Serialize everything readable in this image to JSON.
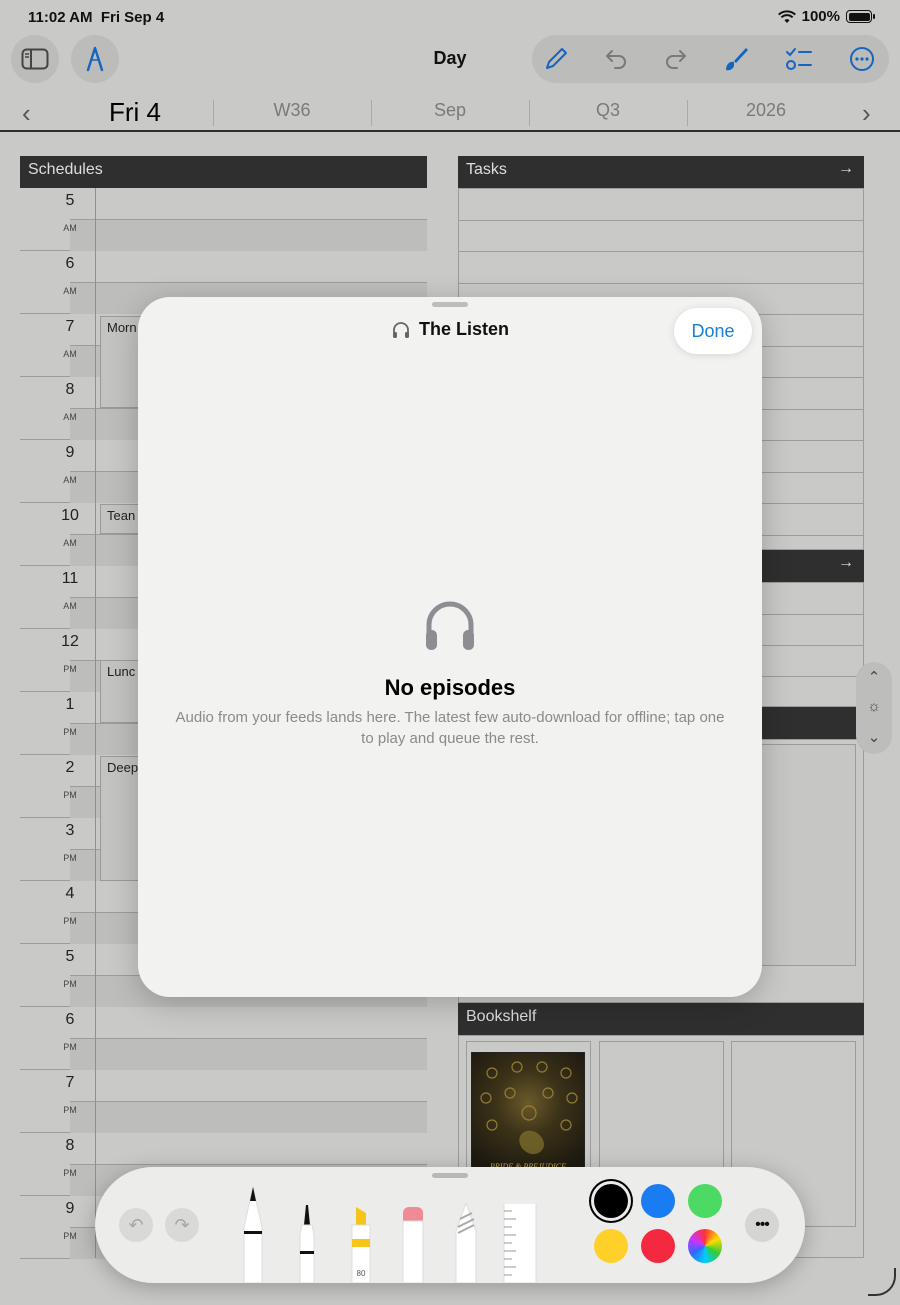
{
  "status_bar": {
    "time": "11:02 AM",
    "date": "Fri Sep 4",
    "battery": "100%"
  },
  "toolbar": {
    "title": "Day",
    "left_icons": [
      "sidebar-icon",
      "pen-mode-icon"
    ],
    "right_icons": [
      "pencil-icon",
      "undo-icon",
      "redo-icon",
      "brush-icon",
      "checklist-icon",
      "more-icon"
    ]
  },
  "date_nav": {
    "day": "Fri 4",
    "week": "W36",
    "month": "Sep",
    "quarter": "Q3",
    "year": "2026"
  },
  "schedules": {
    "header": "Schedules",
    "hours": [
      {
        "num": "5",
        "ampm": "AM"
      },
      {
        "num": "6",
        "ampm": "AM"
      },
      {
        "num": "7",
        "ampm": "AM"
      },
      {
        "num": "8",
        "ampm": "AM"
      },
      {
        "num": "9",
        "ampm": "AM"
      },
      {
        "num": "10",
        "ampm": "AM"
      },
      {
        "num": "11",
        "ampm": "AM"
      },
      {
        "num": "12",
        "ampm": "PM"
      },
      {
        "num": "1",
        "ampm": "PM"
      },
      {
        "num": "2",
        "ampm": "PM"
      },
      {
        "num": "3",
        "ampm": "PM"
      },
      {
        "num": "4",
        "ampm": "PM"
      },
      {
        "num": "5",
        "ampm": "PM"
      },
      {
        "num": "6",
        "ampm": "PM"
      },
      {
        "num": "7",
        "ampm": "PM"
      },
      {
        "num": "8",
        "ampm": "PM"
      },
      {
        "num": "9",
        "ampm": "PM"
      }
    ],
    "events": [
      "Morn",
      "Tean",
      "Lunc",
      "Deep"
    ]
  },
  "panels": {
    "tasks": "Tasks",
    "bookshelf": "Bookshelf",
    "book_cover_text": "PRIDE & PREJUDICE"
  },
  "modal": {
    "title": "The Listen",
    "done": "Done",
    "empty_title": "No episodes",
    "empty_body": "Audio from your feeds lands here. The latest few auto-download for offline; tap one to play and queue the rest."
  },
  "palette": {
    "marker_label": "80",
    "colors": [
      "#000000",
      "#1a7cf2",
      "#4cd964",
      "#ffd02a",
      "#f4283e"
    ]
  }
}
